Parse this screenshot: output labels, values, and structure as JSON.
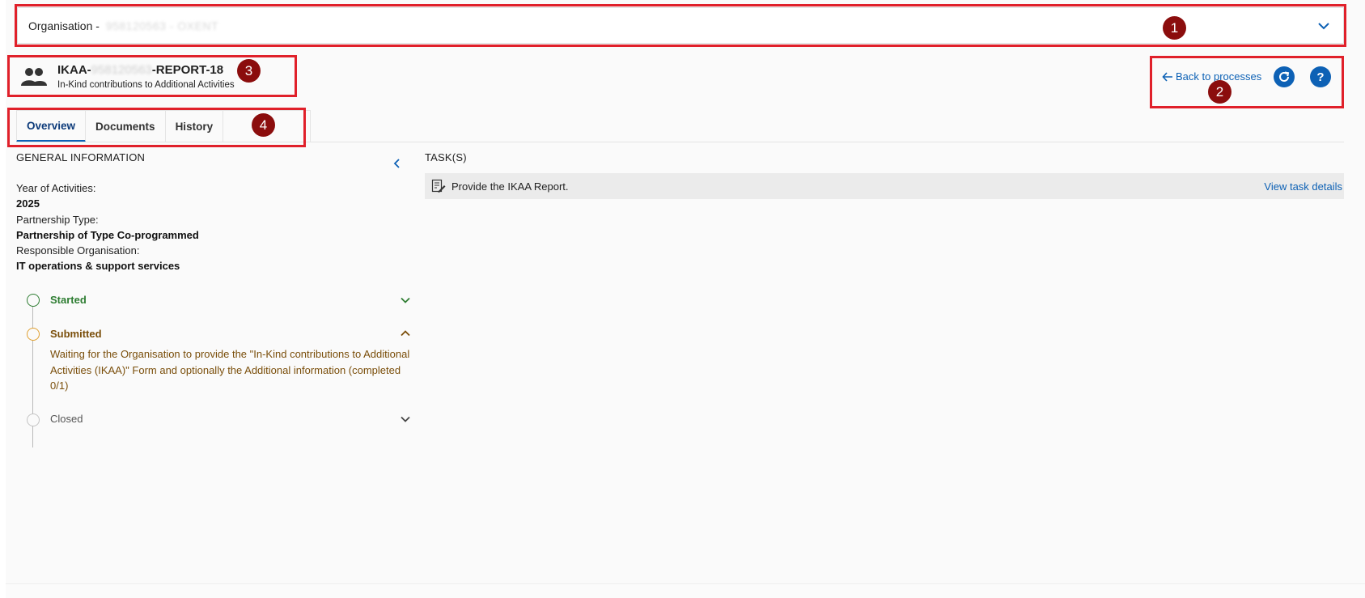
{
  "organisation_selector": {
    "prefix": "Organisation - ",
    "redacted_value": "958120563 - OXENT",
    "icon": "chevron-down-icon"
  },
  "process": {
    "icon": "group-icon",
    "title_prefix": "IKAA-",
    "title_redacted": "958120563",
    "title_suffix": "-REPORT-18",
    "subtitle": "In-Kind contributions to Additional Activities"
  },
  "actions": {
    "back_label": "Back to processes",
    "back_icon": "arrow-left-icon",
    "refresh_icon": "refresh-icon",
    "help_icon": "help-icon"
  },
  "tabs": [
    {
      "label": "Overview",
      "active": true
    },
    {
      "label": "Documents",
      "active": false
    },
    {
      "label": "History",
      "active": false
    }
  ],
  "general_information": {
    "title": "GENERAL INFORMATION",
    "fields": [
      {
        "label": "Year of Activities:",
        "value": "2025"
      },
      {
        "label": "Partnership Type:",
        "value": "Partnership of Type Co-programmed"
      },
      {
        "label": "Responsible Organisation:",
        "value": "IT operations & support services"
      }
    ]
  },
  "timeline": {
    "steps": [
      {
        "label": "Started",
        "state": "done",
        "color": "#2e7d32",
        "expanded": false
      },
      {
        "label": "Submitted",
        "state": "current",
        "color": "#8a5a00",
        "expanded": true,
        "description": "Waiting for the Organisation to provide the \"In-Kind contributions to Additional Activities (IKAA)\" Form and optionally the Additional information (completed 0/1)"
      },
      {
        "label": "Closed",
        "state": "pending",
        "color": "#555555",
        "expanded": false
      }
    ]
  },
  "tasks": {
    "title": "TASK(S)",
    "items": [
      {
        "icon": "edit-document-icon",
        "text": "Provide the IKAA Report.",
        "link": "View task details"
      }
    ]
  },
  "annotations": [
    "1",
    "2",
    "3",
    "4"
  ],
  "colors": {
    "accent": "#0d61b5",
    "annotation_red": "#e0202a",
    "annotation_badge": "#8b0d0d",
    "started_green": "#2e7d32",
    "submitted_amber": "#e0a030"
  }
}
